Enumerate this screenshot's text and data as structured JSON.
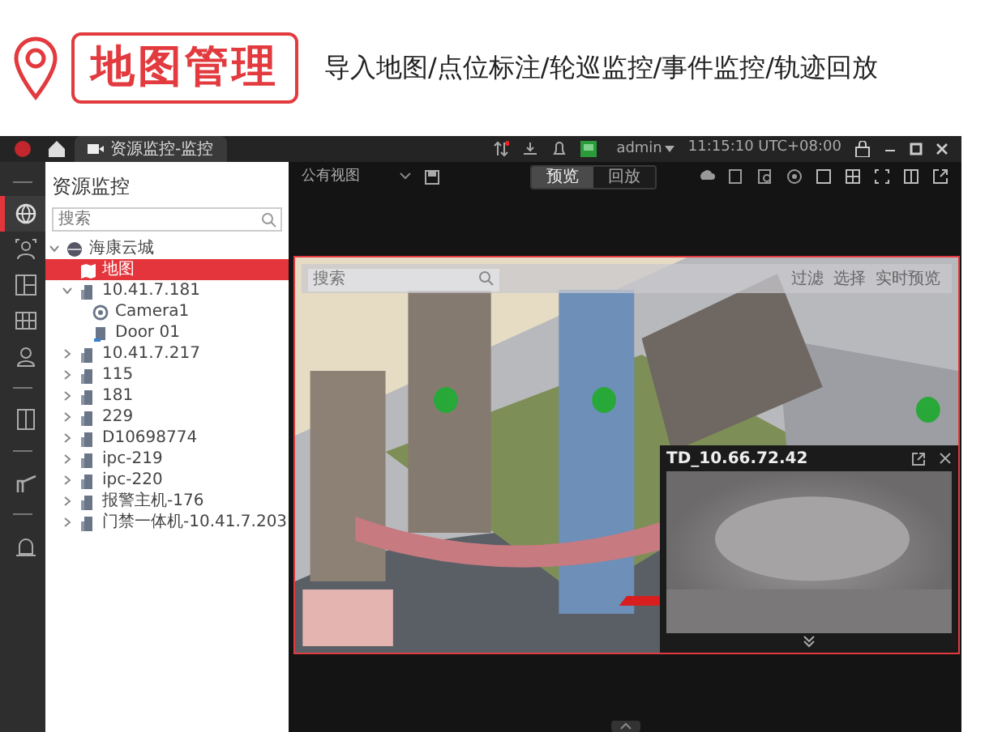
{
  "header": {
    "title": "地图管理",
    "subtitle": "导入地图/点位标注/轮巡监控/事件监控/轨迹回放"
  },
  "titlebar": {
    "tab": "资源监控-监控",
    "user": "admin",
    "time": "11:15:10 UTC+08:00"
  },
  "rail": [
    {
      "kind": "divider"
    },
    {
      "kind": "button",
      "selected": true
    },
    {
      "kind": "button",
      "selected": false
    },
    {
      "kind": "button",
      "selected": false
    },
    {
      "kind": "button",
      "selected": false
    },
    {
      "kind": "button",
      "selected": false
    },
    {
      "kind": "divider"
    },
    {
      "kind": "button",
      "selected": false
    },
    {
      "kind": "divider"
    },
    {
      "kind": "button",
      "selected": false
    },
    {
      "kind": "divider"
    },
    {
      "kind": "button",
      "selected": false
    }
  ],
  "panel": {
    "title": "资源监控",
    "search": {
      "placeholder": "搜索"
    },
    "tree": [
      {
        "label": "海康云城",
        "kind": "cloud",
        "expanded": true,
        "selected": false,
        "children": [
          {
            "label": "地图",
            "kind": "map",
            "selected": true
          },
          {
            "label": "10.41.7.181",
            "kind": "device",
            "expanded": true,
            "selected": false,
            "children": [
              {
                "label": "Camera1",
                "kind": "camera",
                "selected": false
              },
              {
                "label": "Door 01",
                "kind": "door",
                "selected": false
              }
            ]
          },
          {
            "label": "10.41.7.217",
            "kind": "device",
            "expanded": false,
            "selected": false
          },
          {
            "label": "115",
            "kind": "device",
            "expanded": false,
            "selected": false
          },
          {
            "label": "181",
            "kind": "device",
            "expanded": false,
            "selected": false
          },
          {
            "label": "229",
            "kind": "device",
            "expanded": false,
            "selected": false
          },
          {
            "label": "D10698774",
            "kind": "device",
            "expanded": false,
            "selected": false
          },
          {
            "label": "ipc-219",
            "kind": "device",
            "expanded": false,
            "selected": false
          },
          {
            "label": "ipc-220",
            "kind": "device",
            "expanded": false,
            "selected": false
          },
          {
            "label": "报警主机-176",
            "kind": "device",
            "expanded": false,
            "selected": false
          },
          {
            "label": "门禁一体机-10.41.7.203",
            "kind": "device",
            "expanded": false,
            "selected": false
          }
        ]
      }
    ]
  },
  "view": {
    "name": "公有视图",
    "modes": [
      {
        "label": "预览",
        "selected": true
      },
      {
        "label": "回放",
        "selected": false
      }
    ]
  },
  "map": {
    "search": {
      "placeholder": "搜索"
    },
    "tools": [
      "过滤",
      "选择",
      "实时预览"
    ]
  },
  "video_popup": {
    "title": "TD_10.66.72.42"
  }
}
